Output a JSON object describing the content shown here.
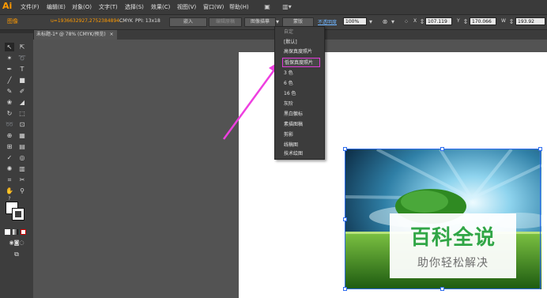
{
  "app": {
    "logo": "Ai"
  },
  "menubar": {
    "items": [
      "文件(F)",
      "编辑(E)",
      "对象(O)",
      "文字(T)",
      "选择(S)",
      "效果(C)",
      "视图(V)",
      "窗口(W)",
      "帮助(H)"
    ]
  },
  "control_bar": {
    "object_type": "图像",
    "file_link": "u=1936632927,2752384894...",
    "color_mode": "CMYK",
    "ppi": "PPI: 13x18",
    "embed_button": "嵌入",
    "edit_original_button": "编辑原稿",
    "trace_preset": "图像描摹",
    "mask_button": "蒙版",
    "opacity_label": "不透明度",
    "opacity_value": "100%",
    "x_value": "107.119",
    "y_value": "170.066",
    "w_value": "193.92"
  },
  "document_tab": {
    "title": "未标题-1* @ 78% (CMYK/预览)",
    "close": "×"
  },
  "dropdown": {
    "header": "自定",
    "items": [
      "[默认]",
      "高保真度照片",
      "低保真度照片",
      "3 色",
      "6 色",
      "16 色",
      "灰阶",
      "黑白徽标",
      "素描图稿",
      "剪影",
      "线稿图",
      "技术绘图"
    ],
    "highlighted_index": 2
  },
  "toolbox": {
    "tools": [
      "selection",
      "direct-selection",
      "magic-wand",
      "lasso",
      "pen",
      "type",
      "line",
      "rectangle",
      "paintbrush",
      "pencil",
      "blob-brush",
      "eraser",
      "rotate",
      "scale",
      "warp",
      "free-transform",
      "shape-builder",
      "perspective",
      "mesh",
      "gradient",
      "eyedropper",
      "blend",
      "symbol-sprayer",
      "column-graph",
      "artboard",
      "slice",
      "hand",
      "zoom"
    ]
  },
  "watermark": {
    "title": "百科全说",
    "subtitle": "助你轻松解决"
  },
  "colors": {
    "accent": "#ff9a00",
    "highlight_border": "#e03bd8",
    "arrow": "#ee3fe0",
    "selection": "#2f6df0",
    "watermark_green": "#31a646"
  }
}
